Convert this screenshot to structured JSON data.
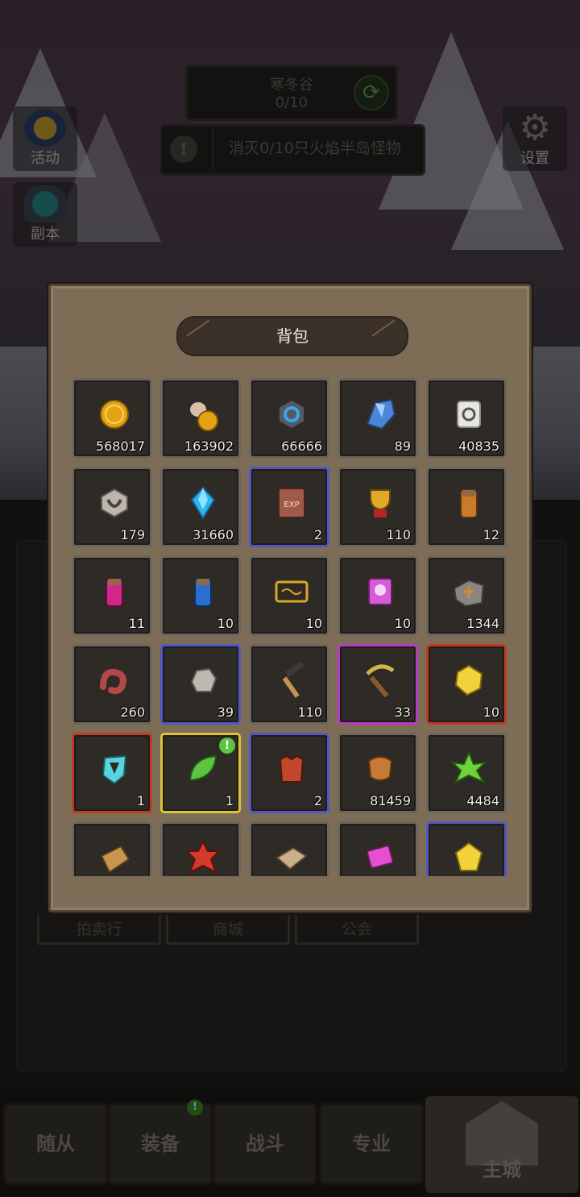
{
  "header": {
    "zone_name": "寒冬谷",
    "zone_progress": "0/10",
    "quest_text": "消灭0/10只火焰半岛怪物"
  },
  "side_buttons": {
    "activity_label": "活动",
    "dungeon_label": "副本",
    "settings_label": "设置"
  },
  "background_tabs": [
    "拍卖行",
    "商城",
    "公会"
  ],
  "bottom_nav": {
    "items": [
      "随从",
      "装备",
      "战斗",
      "专业"
    ],
    "main_city": "主城"
  },
  "bag": {
    "title": "背包",
    "items": [
      {
        "name": "gold-coin",
        "count": "568017",
        "quality": "normal"
      },
      {
        "name": "coin-pouch",
        "count": "163902",
        "quality": "normal"
      },
      {
        "name": "blue-rune-token",
        "count": "66666",
        "quality": "normal"
      },
      {
        "name": "blue-crystal-ore",
        "count": "89",
        "quality": "normal"
      },
      {
        "name": "scroll",
        "count": "40835",
        "quality": "normal"
      },
      {
        "name": "stone-rune",
        "count": "179",
        "quality": "normal"
      },
      {
        "name": "blue-gem",
        "count": "31660",
        "quality": "normal"
      },
      {
        "name": "exp-book",
        "count": "2",
        "quality": "blue"
      },
      {
        "name": "trophy-cup",
        "count": "110",
        "quality": "normal"
      },
      {
        "name": "orange-potion",
        "count": "12",
        "quality": "normal"
      },
      {
        "name": "pink-potion",
        "count": "11",
        "quality": "normal"
      },
      {
        "name": "blue-potion",
        "count": "10",
        "quality": "normal"
      },
      {
        "name": "gold-ticket",
        "count": "10",
        "quality": "normal"
      },
      {
        "name": "skull-ticket",
        "count": "10",
        "quality": "normal"
      },
      {
        "name": "map-fragment",
        "count": "1344",
        "quality": "normal"
      },
      {
        "name": "red-worm",
        "count": "260",
        "quality": "normal"
      },
      {
        "name": "grey-stone",
        "count": "39",
        "quality": "blue"
      },
      {
        "name": "hammer",
        "count": "110",
        "quality": "normal"
      },
      {
        "name": "pickaxe",
        "count": "33",
        "quality": "purple"
      },
      {
        "name": "gold-nugget",
        "count": "10",
        "quality": "red"
      },
      {
        "name": "cyan-shard",
        "count": "1",
        "quality": "red"
      },
      {
        "name": "green-leaf",
        "count": "1",
        "quality": "yellow",
        "new": true
      },
      {
        "name": "red-armor",
        "count": "2",
        "quality": "blue"
      },
      {
        "name": "leather-hide",
        "count": "81459",
        "quality": "normal"
      },
      {
        "name": "green-herb",
        "count": "4484",
        "quality": "normal"
      },
      {
        "name": "wood-plank",
        "count": "",
        "quality": "normal"
      },
      {
        "name": "red-flower",
        "count": "",
        "quality": "normal"
      },
      {
        "name": "cloth-scrap",
        "count": "",
        "quality": "normal"
      },
      {
        "name": "pink-card",
        "count": "",
        "quality": "normal"
      },
      {
        "name": "yellow-crystal",
        "count": "",
        "quality": "blue"
      }
    ]
  },
  "colors": {
    "panel": "#7d6d57",
    "cell_bg": "#2e2a25",
    "quality_blue": "#5257c8",
    "quality_purple": "#b53cc4",
    "quality_red": "#c23a26",
    "quality_yellow": "#d9c437"
  }
}
